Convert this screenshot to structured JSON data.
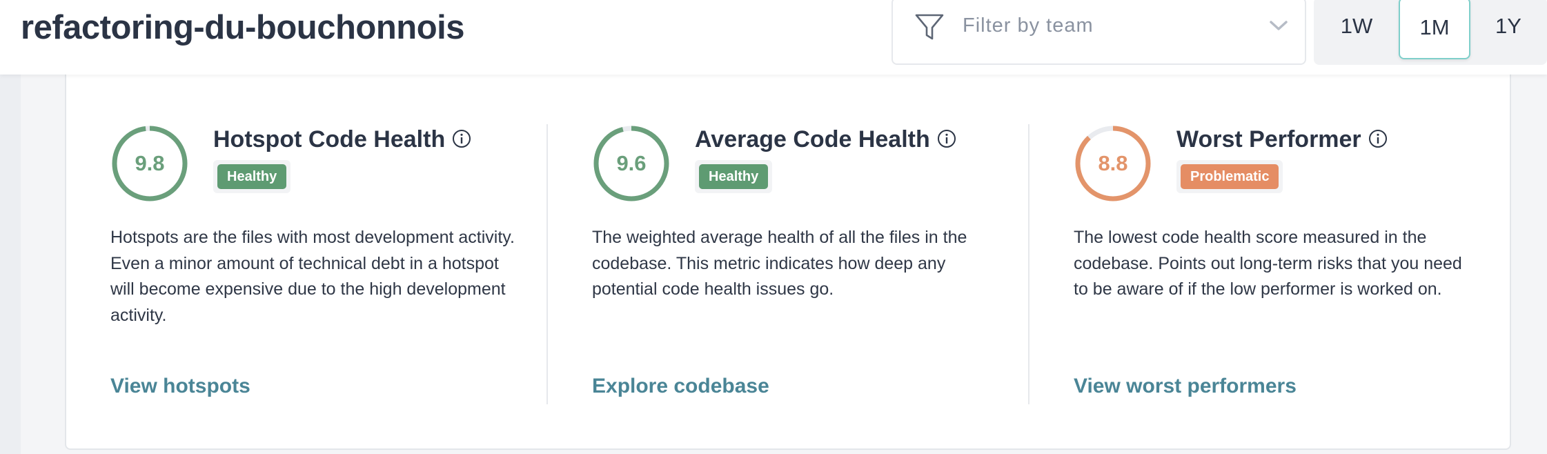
{
  "header": {
    "project_title": "refactoring-du-bouchonnois",
    "filter": {
      "placeholder": "Filter by team"
    },
    "periods": [
      {
        "label": "1W",
        "active": false
      },
      {
        "label": "1M",
        "active": true
      },
      {
        "label": "1Y",
        "active": false
      }
    ]
  },
  "metrics": [
    {
      "score": "9.8",
      "score_fraction": 0.98,
      "title": "Hotspot Code Health",
      "status": "Healthy",
      "color": "#6a9f7b",
      "badge_color": "#5e9b72",
      "description": "Hotspots are the files with most development activity. Even a minor amount of technical debt in a hotspot will become expensive due to the high development activity.",
      "link": "View hotspots"
    },
    {
      "score": "9.6",
      "score_fraction": 0.96,
      "title": "Average Code Health",
      "status": "Healthy",
      "color": "#6a9f7b",
      "badge_color": "#5e9b72",
      "description": "The weighted average health of all the files in the codebase. This metric indicates how deep any potential code health issues go.",
      "link": "Explore codebase"
    },
    {
      "score": "8.8",
      "score_fraction": 0.88,
      "title": "Worst Performer",
      "status": "Problematic",
      "color": "#e3946a",
      "badge_color": "#e58d64",
      "description": "The lowest code health score measured in the codebase. Points out long-term risks that you need to be aware of if the low performer is worked on.",
      "link": "View worst performers"
    }
  ]
}
